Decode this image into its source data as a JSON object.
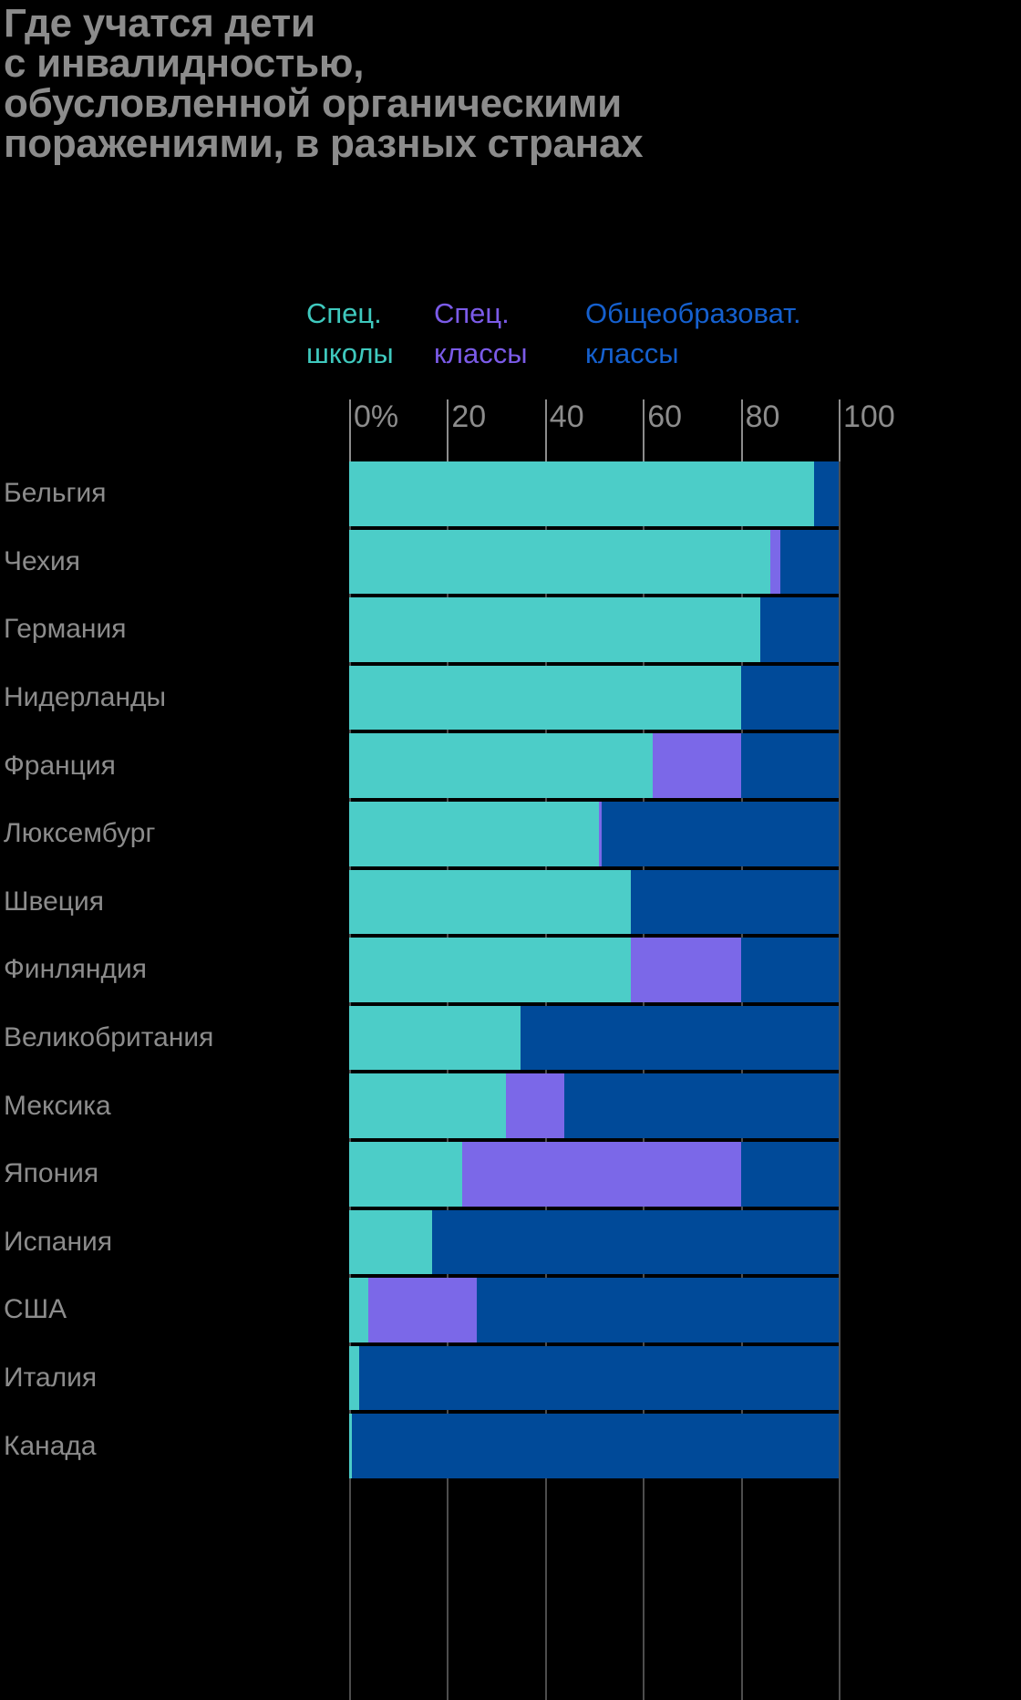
{
  "title": {
    "lines": [
      "Где учатся дети",
      "с инвалидностью,",
      "обусловленной органическими",
      "поражениями, в разных странах"
    ]
  },
  "legend": [
    {
      "key": "special_schools",
      "line1": "Спец.",
      "line2": "школы",
      "color": "#3FC9BE"
    },
    {
      "key": "special_classes",
      "line1": "Спец.",
      "line2": "классы",
      "color": "#7B5BE8"
    },
    {
      "key": "general_classes",
      "line1": "Общеобразоват.",
      "line2": "классы",
      "color": "#1560CE"
    }
  ],
  "axis": {
    "ticks": [
      "0%",
      "20",
      "40",
      "60",
      "80",
      "100"
    ],
    "values": [
      0,
      20,
      40,
      60,
      80,
      100
    ]
  },
  "chart_data": {
    "type": "bar",
    "orientation": "horizontal",
    "stacked": true,
    "stack_total": 100,
    "title": "Где учатся дети с инвалидностью, обусловленной органическими поражениями, в разных странах",
    "xlabel": "",
    "ylabel": "",
    "xlim": [
      0,
      100
    ],
    "grid": true,
    "legend_position": "top",
    "categories": [
      "Бельгия",
      "Чехия",
      "Германия",
      "Нидерланды",
      "Франция",
      "Люксембург",
      "Швеция",
      "Финляндия",
      "Великобритания",
      "Мексика",
      "Япония",
      "Испания",
      "США",
      "Италия",
      "Канада"
    ],
    "series": [
      {
        "name": "Спец. школы",
        "color": "#4CCDC8",
        "values": [
          95,
          86,
          84,
          80,
          62,
          51,
          57.5,
          57.5,
          35,
          32,
          23,
          17,
          4,
          2,
          0.5
        ]
      },
      {
        "name": "Спец. классы",
        "color": "#7B68E8",
        "values": [
          0,
          2,
          0,
          0,
          18,
          0.5,
          0,
          22.5,
          0,
          12,
          57,
          0,
          22,
          0,
          0
        ]
      },
      {
        "name": "Общеобразоват. классы",
        "color": "#004A99",
        "values": [
          5,
          12,
          16,
          20,
          20,
          48.5,
          42.5,
          20,
          65,
          56,
          20,
          83,
          74,
          98,
          99.5
        ]
      }
    ]
  },
  "colors": {
    "background": "#000000",
    "text": "#8c8c8c",
    "special_schools": "#4CCDC8",
    "special_classes": "#7B68E8",
    "general_classes": "#004A99",
    "gridline": "rgba(255,255,255,0.30)"
  }
}
